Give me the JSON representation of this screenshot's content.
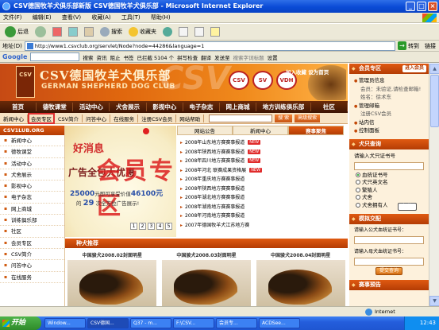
{
  "window": {
    "title": "CSV德国牧羊犬俱乐部新版 CSV德国牧羊犬俱乐部 - Microsoft Internet Explorer",
    "controls": [
      "_",
      "□",
      "×"
    ]
  },
  "menubar": [
    "文件(F)",
    "编辑(E)",
    "查看(V)",
    "收藏(A)",
    "工具(T)",
    "帮助(H)"
  ],
  "toolbar": {
    "back": "后退",
    "search": "搜索",
    "favorites": "收藏夹"
  },
  "address": {
    "label": "地址(D)",
    "url": "http://www1.csvclub.org/servlet/Node?node=44286&language=1",
    "go": "转到",
    "links": "链接"
  },
  "googlebar": {
    "logo": "Google",
    "go_label": "搜索",
    "items": [
      "资讯",
      "阻止",
      "书签",
      "已拦截 5104 个",
      "拼写检查",
      "翻译",
      "发送至",
      "搜索字词标题"
    ],
    "settings": "设置"
  },
  "site": {
    "banner": {
      "logo_text": "CSV",
      "title_zh": "CSV德国牧羊犬俱乐部",
      "title_en": "GERMAN SHEPHERD DOG CLUB",
      "watermark": "CSV",
      "sponsors": [
        "CSV",
        "SV",
        "VDH"
      ]
    },
    "top_links": "加入收藏 设为首页",
    "nav": [
      "首页",
      "德牧课堂",
      "活动中心",
      "犬舍展示",
      "影视中心",
      "电子杂志",
      "网上商城",
      "地方训练俱乐部",
      "社区"
    ],
    "subnav": [
      "新闻中心",
      "会员专区",
      "CSV简介",
      "问答中心",
      "在线服务",
      "注册CSV会员",
      "网站帮助"
    ],
    "subnav_buttons": [
      "搜 索",
      "高级搜索"
    ],
    "left_title": "CSV1LUB.ORG",
    "left_nav": [
      "新闻中心",
      "德牧课堂",
      "活动中心",
      "犬舍展示",
      "影视中心",
      "电子杂志",
      "网上商城",
      "训练俱乐部",
      "社区",
      "会员专区",
      "CSV简介",
      "问答中心",
      "在线服务"
    ],
    "promo": {
      "line1": "好消息",
      "line2": "广告全包大优惠",
      "overlay": "会员专区",
      "price_prefix": "25000",
      "price_mid": "元即可享受价值",
      "price_value": "46100元",
      "line4_prefix": "的",
      "line4_count": "29",
      "line4_suffix": "次全方位广告展示!",
      "pages": [
        "1",
        "2",
        "3",
        "4",
        "5"
      ]
    },
    "news_tabs": [
      "网站公告",
      "新闻中心",
      "赛事聚焦"
    ],
    "news_items": [
      "2008年山东地方赛赛事报道",
      "2008年陕西地方赛赛事报道",
      "2008年四川地方赛赛事报道",
      "2008年河北 联赛成果资格展",
      "2008年重庆地方赛赛事报道",
      "2008年陕西地方赛赛事报道",
      "2008年湖北地方赛赛事报道",
      "2008年湖南地方赛赛事报道",
      "2008年河南地方赛赛事报道",
      "2007年德国牧羊犬江苏地方赛"
    ],
    "new_badge": "NEW",
    "section_title": "种犬推荐",
    "dogs": [
      "中国骏犬2008.02封面明星",
      "中国骏犬2008.03封面明星",
      "中国骏犬2008.04封面明星"
    ],
    "right": {
      "member_title": "会员专区",
      "member_sub": "进入会员",
      "member_items": [
        "管理员信息",
        "会员：未验证,请检查邮箱!",
        "姓名：徐术东",
        "管理邮箱",
        "注册CSV会员",
        "站内信",
        "控制面板"
      ],
      "dog_query_title": "犬只查询",
      "dog_query_placeholder": "请输入犬只证书号",
      "radio": [
        "血统证书号",
        "犬只英文名",
        "繁殖人",
        "犬舍",
        "犬舍拥有人"
      ],
      "query_btn": "查 询",
      "mating_title": "模拟交配",
      "mating_lines": [
        "请输入公犬血统证书号：",
        "请输入母犬血统证书号："
      ],
      "mating_btn": "提交查询",
      "events_title": "赛事预告"
    }
  },
  "status": {
    "text": "",
    "zone": "Internet"
  },
  "taskbar": {
    "start": "开始",
    "tasks": [
      "Window...",
      "CSV德国...",
      "Q37 - m...",
      "F:\\CSV...",
      "会员专...",
      "ACDSee..."
    ],
    "clock": "12:43"
  }
}
